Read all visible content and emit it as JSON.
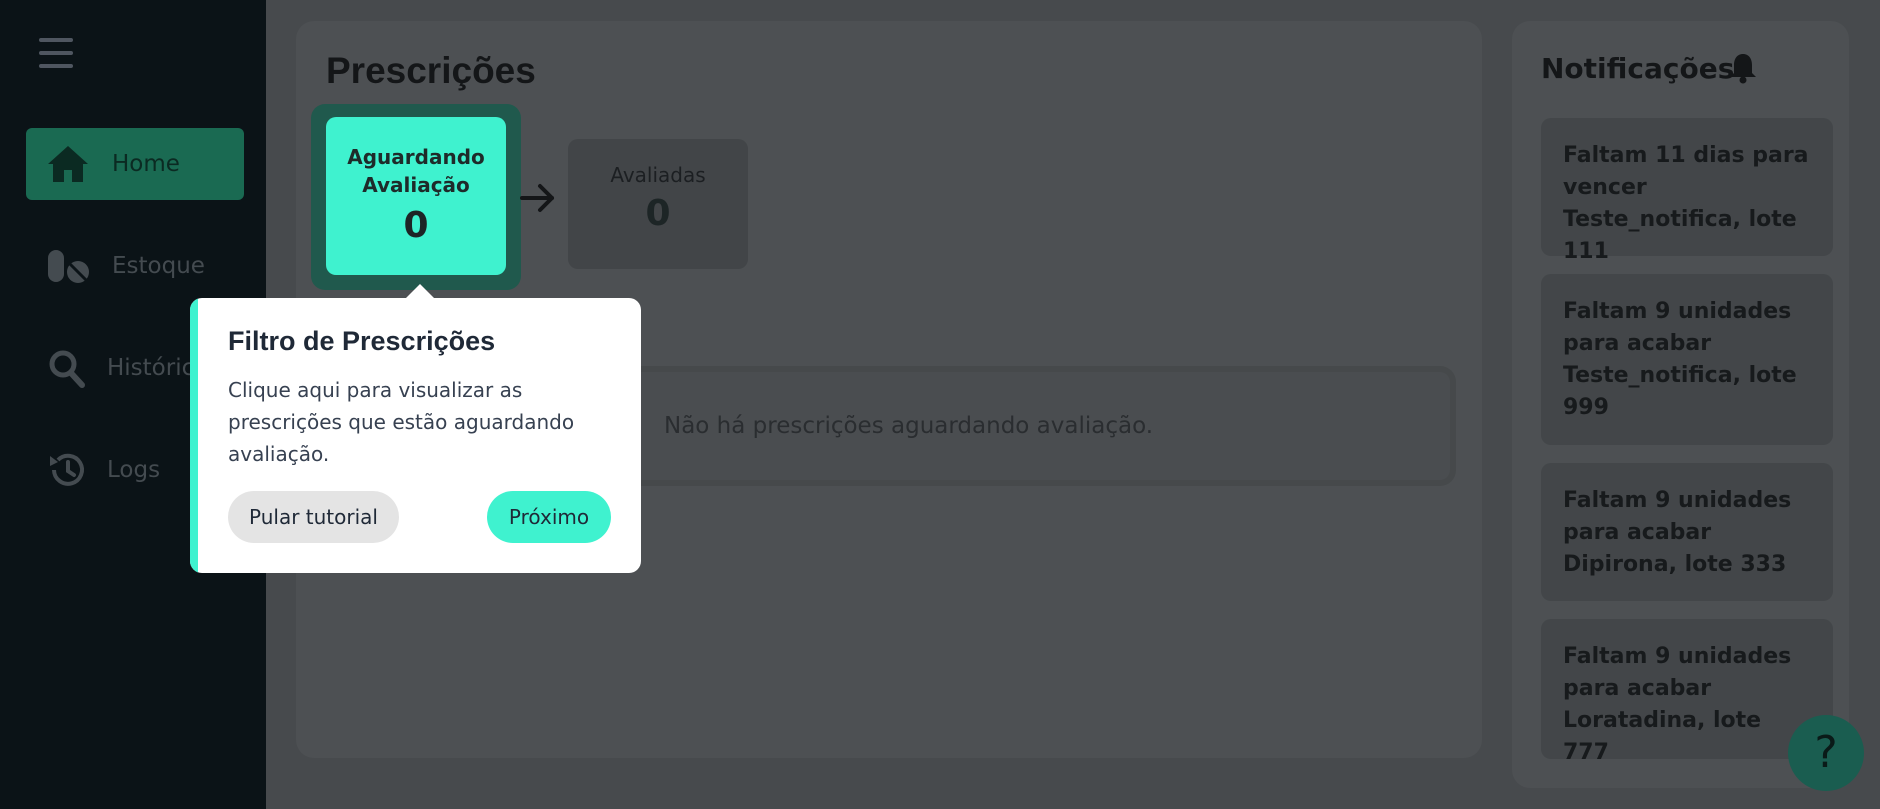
{
  "sidebar": {
    "items": [
      {
        "label": "Home",
        "icon": "home-icon"
      },
      {
        "label": "Estoque",
        "icon": "pills-icon"
      },
      {
        "label": "Históric",
        "icon": "search-icon"
      },
      {
        "label": "Logs",
        "icon": "history-icon"
      }
    ]
  },
  "main": {
    "title": "Prescrições",
    "cards": [
      {
        "label": "Aguardando Avaliação",
        "value": "0"
      },
      {
        "label": "Avaliadas",
        "value": "0"
      }
    ],
    "empty_message": "Não há prescrições aguardando avaliação."
  },
  "notifications": {
    "title": "Notificações",
    "items": [
      "Faltam 11 dias para vencer Teste_notifica, lote 111",
      "Faltam 9 unidades para acabar Teste_notifica, lote 999",
      "Faltam 9 unidades para acabar Dipirona, lote 333",
      "Faltam 9 unidades para acabar Loratadina, lote 777"
    ]
  },
  "tutorial": {
    "title": "Filtro de Prescrições",
    "text": "Clique aqui para visualizar as prescrições que estão aguardando avaliação.",
    "skip_label": "Pular tutorial",
    "next_label": "Próximo"
  },
  "help": {
    "label": "?"
  },
  "colors": {
    "accent": "#3ff2cf",
    "active_nav": "#1a6a52",
    "sidebar": "#0b1317"
  }
}
